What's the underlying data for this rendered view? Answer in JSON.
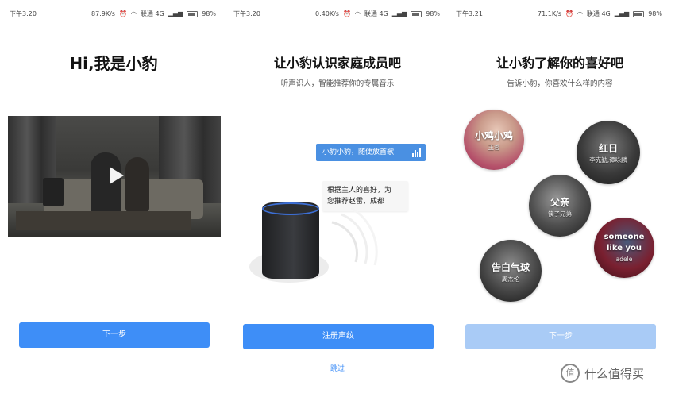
{
  "screens": [
    {
      "status": {
        "time": "下午3:20",
        "speed": "87.9K/s",
        "carrier": "联通 4G",
        "battery": "98%"
      },
      "title": "Hi,我是小豹",
      "button": "下一步"
    },
    {
      "status": {
        "time": "下午3:20",
        "speed": "0.40K/s",
        "carrier": "联通 4G",
        "battery": "98%"
      },
      "title": "让小豹认识家庭成员吧",
      "subtitle": "听声识人，智能推荐你的专属音乐",
      "bubble_command": "小豹小豹，随便放首歌",
      "bubble_reply_line1": "根据主人的喜好，为",
      "bubble_reply_line2": "您推荐赵雷，成都",
      "button": "注册声纹",
      "skip": "跳过"
    },
    {
      "status": {
        "time": "下午3:21",
        "speed": "71.1K/s",
        "carrier": "联通 4G",
        "battery": "98%"
      },
      "title": "让小豹了解你的喜好吧",
      "subtitle": "告诉小豹，你喜欢什么样的内容",
      "circles": [
        {
          "name": "小鸡小鸡",
          "sub": "王蓉"
        },
        {
          "name": "红日",
          "sub": "李克勤,谭咏麟"
        },
        {
          "name": "父亲",
          "sub": "筷子兄弟"
        },
        {
          "name": "someone like you",
          "sub": "adele"
        },
        {
          "name": "告白气球",
          "sub": "周杰伦"
        }
      ],
      "button": "下一步"
    }
  ],
  "watermark": "什么值得买",
  "watermark_icon": "值",
  "colors": {
    "primary": "#3e8ef7",
    "primary_disabled": "#a9cbf6",
    "bubble_blue": "#4a90e2"
  },
  "icons": [
    "wifi-icon",
    "alarm-icon",
    "signal-icon",
    "battery-icon",
    "play-icon",
    "voice-bars-icon",
    "sound-wave-icon"
  ]
}
